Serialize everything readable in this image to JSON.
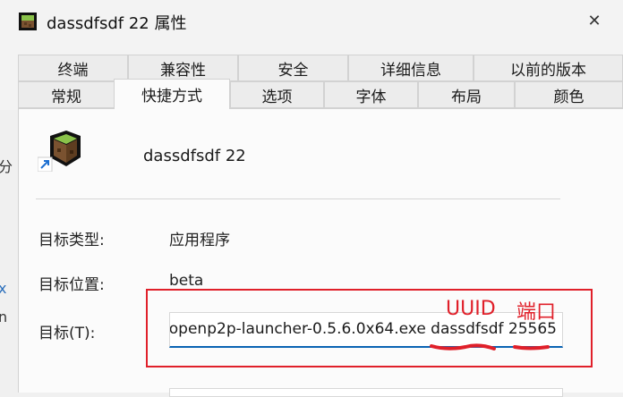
{
  "window": {
    "title": "dassdfsdf 22 属性",
    "close_glyph": "✕"
  },
  "tabs_row1": [
    "终端",
    "兼容性",
    "安全",
    "详细信息",
    "以前的版本"
  ],
  "tabs_row2": [
    "常规",
    "快捷方式",
    "选项",
    "字体",
    "布局",
    "颜色"
  ],
  "active_tab": "快捷方式",
  "shortcut": {
    "name": "dassdfsdf 22",
    "target_type_label": "目标类型:",
    "target_type_value": "应用程序",
    "target_location_label": "目标位置:",
    "target_location_value": "beta",
    "target_label": "目标(T):",
    "target_value": "openp2p-launcher-0.5.6.0x64.exe dassdfsdf 25565"
  },
  "annotations": {
    "uuid": "UUID",
    "port": "端口",
    "color": "#e0202a"
  },
  "edge_fragments": [
    "分",
    "x",
    "n"
  ]
}
